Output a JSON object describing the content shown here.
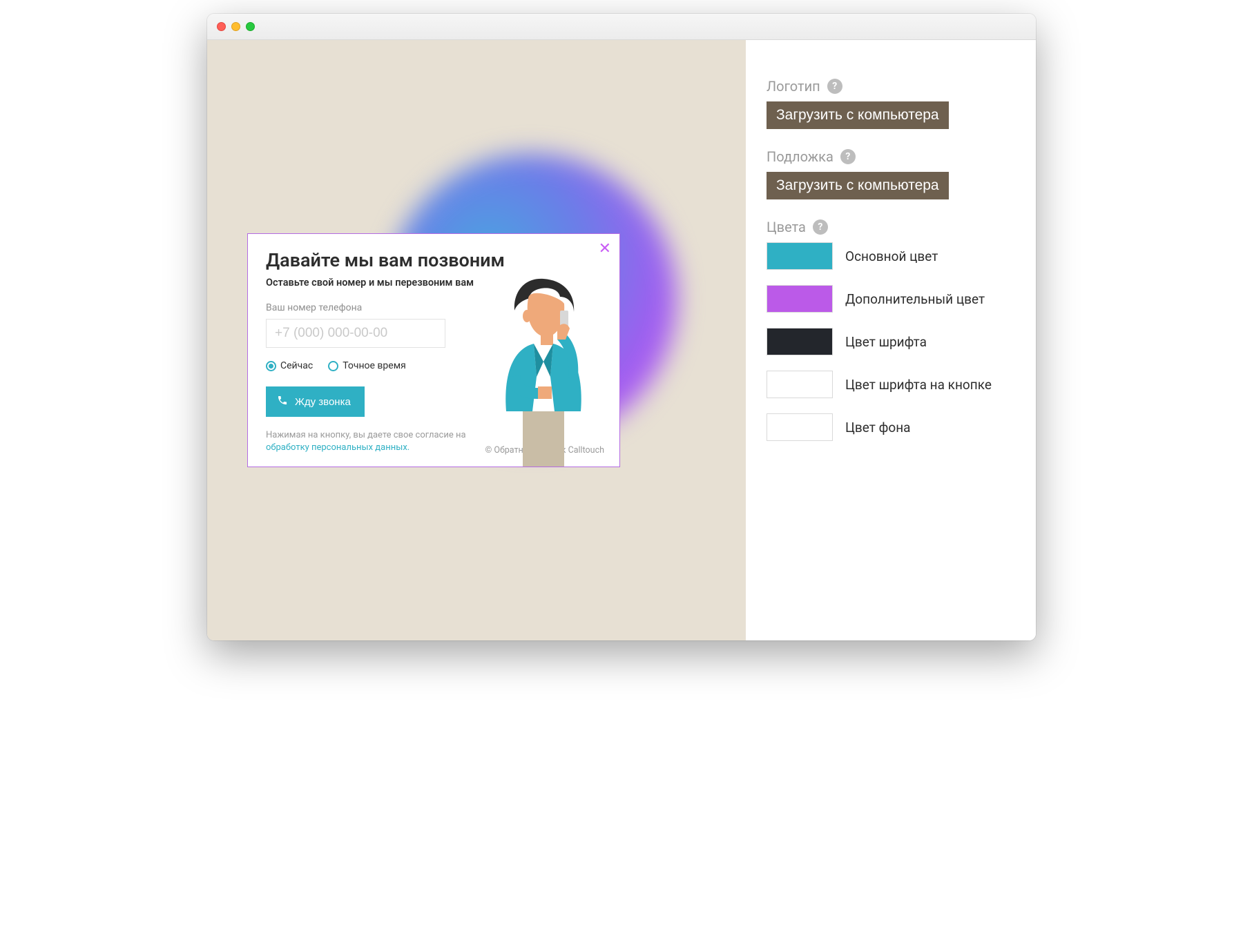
{
  "widget": {
    "title": "Давайте мы вам позвоним",
    "subtitle": "Оставьте свой номер и мы перезвоним вам",
    "phone_label": "Ваш номер телефона",
    "phone_placeholder": "+7 (000) 000-00-00",
    "radio_now": "Сейчас",
    "radio_exact": "Точное время",
    "cta_label": "Жду звонка",
    "consent_prefix": "Нажимая на кнопку, вы даете свое согласие на ",
    "consent_link": "обработку персональных данных.",
    "copyright": "© Обратный звонок Calltouch"
  },
  "sidebar": {
    "logo_label": "Логотип",
    "logo_button": "Загрузить с компьютера",
    "backdrop_label": "Подложка",
    "backdrop_button": "Загрузить с компьютера",
    "colors_label": "Цвета",
    "colors": [
      {
        "hex": "#2fb0c4",
        "label": "Основной цвет"
      },
      {
        "hex": "#bb5ae8",
        "label": "Дополнительный цвет"
      },
      {
        "hex": "#23262c",
        "label": "Цвет шрифта"
      },
      {
        "hex": "#ffffff",
        "label": "Цвет шрифта на кнопке"
      },
      {
        "hex": "#ffffff",
        "label": "Цвет фона"
      }
    ]
  }
}
